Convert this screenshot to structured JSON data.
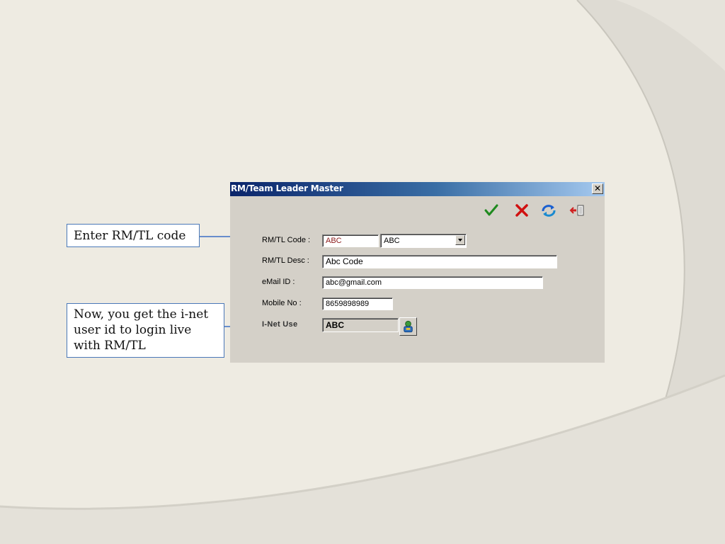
{
  "callouts": {
    "rm_code": "Enter RM/TL code",
    "inet_user": "Now, you get the i-net user id to login live with RM/TL"
  },
  "dialog": {
    "title": "RM/Team Leader Master",
    "close_label": "✕",
    "toolbar": {
      "save_icon": "check-icon",
      "cancel_icon": "x-icon",
      "refresh_icon": "refresh-icon",
      "exit_icon": "exit-door-icon"
    },
    "fields": {
      "rm_tl_code_label": "RM/TL Code :",
      "rm_tl_code_value": "ABC",
      "rm_tl_code_select": "ABC",
      "rm_tl_desc_label": "RM/TL Desc :",
      "rm_tl_desc_value": "Abc Code",
      "email_label": "eMail ID :",
      "email_value": "abc@gmail.com",
      "mobile_label": "Mobile No :",
      "mobile_value": "8659898989",
      "inet_label": "I-Net  Use",
      "inet_value": "ABC"
    }
  },
  "colors": {
    "accent": "#4a78b8",
    "titlebar": "#0a246a",
    "dialog_bg": "#d4d0c8",
    "slide_bg": "#eeebe2"
  }
}
